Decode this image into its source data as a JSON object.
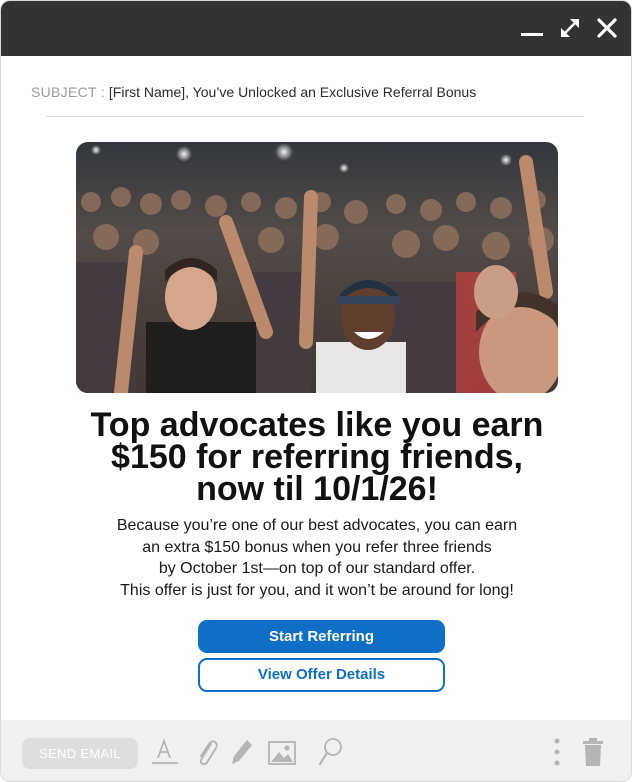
{
  "window": {
    "controls": {
      "minimize_icon": "minimize-icon",
      "maximize_icon": "expand-icon",
      "close_icon": "close-icon"
    }
  },
  "email": {
    "subject_label": "SUBJECT :",
    "subject": "[First Name], You’ve Unlocked an Exclusive Referral Bonus",
    "hero_image": "concert crowd photo",
    "headline_lines": [
      "Top advocates like you earn",
      "$150 for referring friends,",
      "now til 10/1/26!"
    ],
    "body_lines": [
      "Because you’re one of our best advocates, you can earn",
      "an extra $150 bonus when you refer three friends",
      "by October 1st—on top of our standard offer.",
      "This offer is just for you, and it won’t be around for long!"
    ],
    "primary_button": "Start Referring",
    "secondary_button": "View Offer Details"
  },
  "toolbar": {
    "send_label": "SEND EMAIL",
    "icons": [
      "text-format-icon",
      "paperclip-icon",
      "pen-icon",
      "image-icon",
      "search-icon",
      "more-vertical-icon",
      "trash-icon"
    ]
  },
  "colors": {
    "titlebar": "#333333",
    "accent": "#0f6fc6",
    "toolbar_bg": "#f0f0f0"
  }
}
